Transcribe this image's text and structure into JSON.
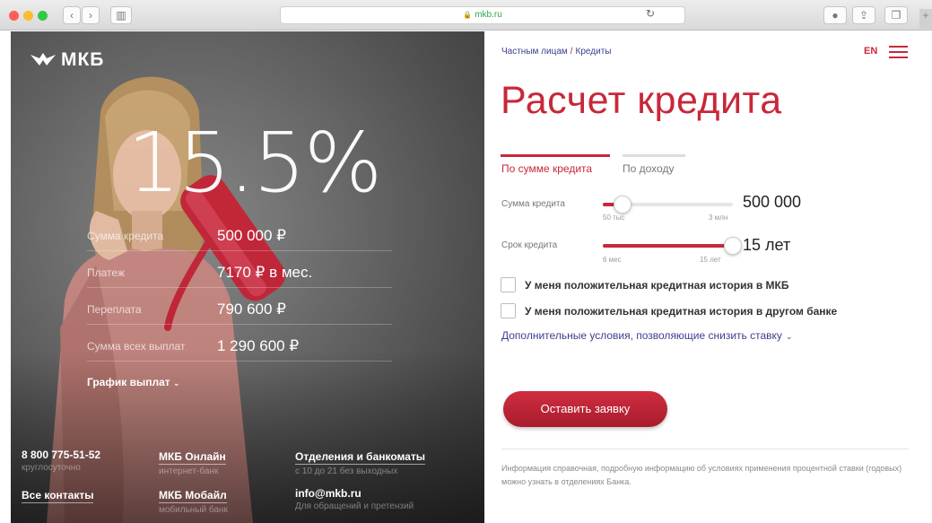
{
  "browser": {
    "url": "mkb.ru",
    "sidebar_icon": "sidebar-icon",
    "reload_icon": "reload-icon",
    "toolbar_icons": [
      "info-icon",
      "share-icon",
      "tabs-icon"
    ],
    "new_tab": "+"
  },
  "hero": {
    "logo_text": "МКБ",
    "rate": "15.5%",
    "stats": [
      {
        "label": "Сумма кредита",
        "value": "500 000 ₽"
      },
      {
        "label": "Платеж",
        "value": "7170 ₽ в мес."
      },
      {
        "label": "Переплата",
        "value": "790 600 ₽"
      },
      {
        "label": "Сумма всех выплат",
        "value": "1 290 600 ₽"
      }
    ],
    "schedule_link": "График выплат",
    "footer": {
      "phone": "8 800 775-51-52",
      "phone_sub": "круглосуточно",
      "online": "МКБ Онлайн",
      "online_sub": "интернет-банк",
      "branches": "Отделения и банкоматы",
      "branches_sub": "с 10 до 21 без выходных",
      "contacts": "Все контакты",
      "mobile": "МКБ Мобайл",
      "mobile_sub": "мобильный банк",
      "email": "info@mkb.ru",
      "email_sub": "Для обращений и претензий"
    }
  },
  "form": {
    "breadcrumb": [
      "Частным лицам",
      "Кредиты"
    ],
    "breadcrumb_sep": "/",
    "lang": "EN",
    "title": "Расчет кредита",
    "tabs": [
      "По сумме кредита",
      "По доходу"
    ],
    "amount": {
      "label": "Сумма кредита",
      "min_label": "50 тыс",
      "max_label": "3 млн",
      "value": "500 000",
      "fill_fraction": 0.15
    },
    "term": {
      "label": "Срок кредита",
      "min_label": "6 мес",
      "max_label": "15 лет",
      "value": "15 лет",
      "fill_fraction": 1.0
    },
    "checkboxes": [
      "У меня положительная кредитная история в МКБ",
      "У меня положительная кредитная история в другом банке"
    ],
    "more_conditions": "Дополнительные условия, позволяющие снизить ставку",
    "submit": "Оставить заявку",
    "note": "Информация справочная, подробную информацию об условиях применения процентной ставки (годовых) можно узнать в отделениях Банка."
  },
  "colors": {
    "accent": "#c8283a",
    "link": "#3d3f8c"
  }
}
